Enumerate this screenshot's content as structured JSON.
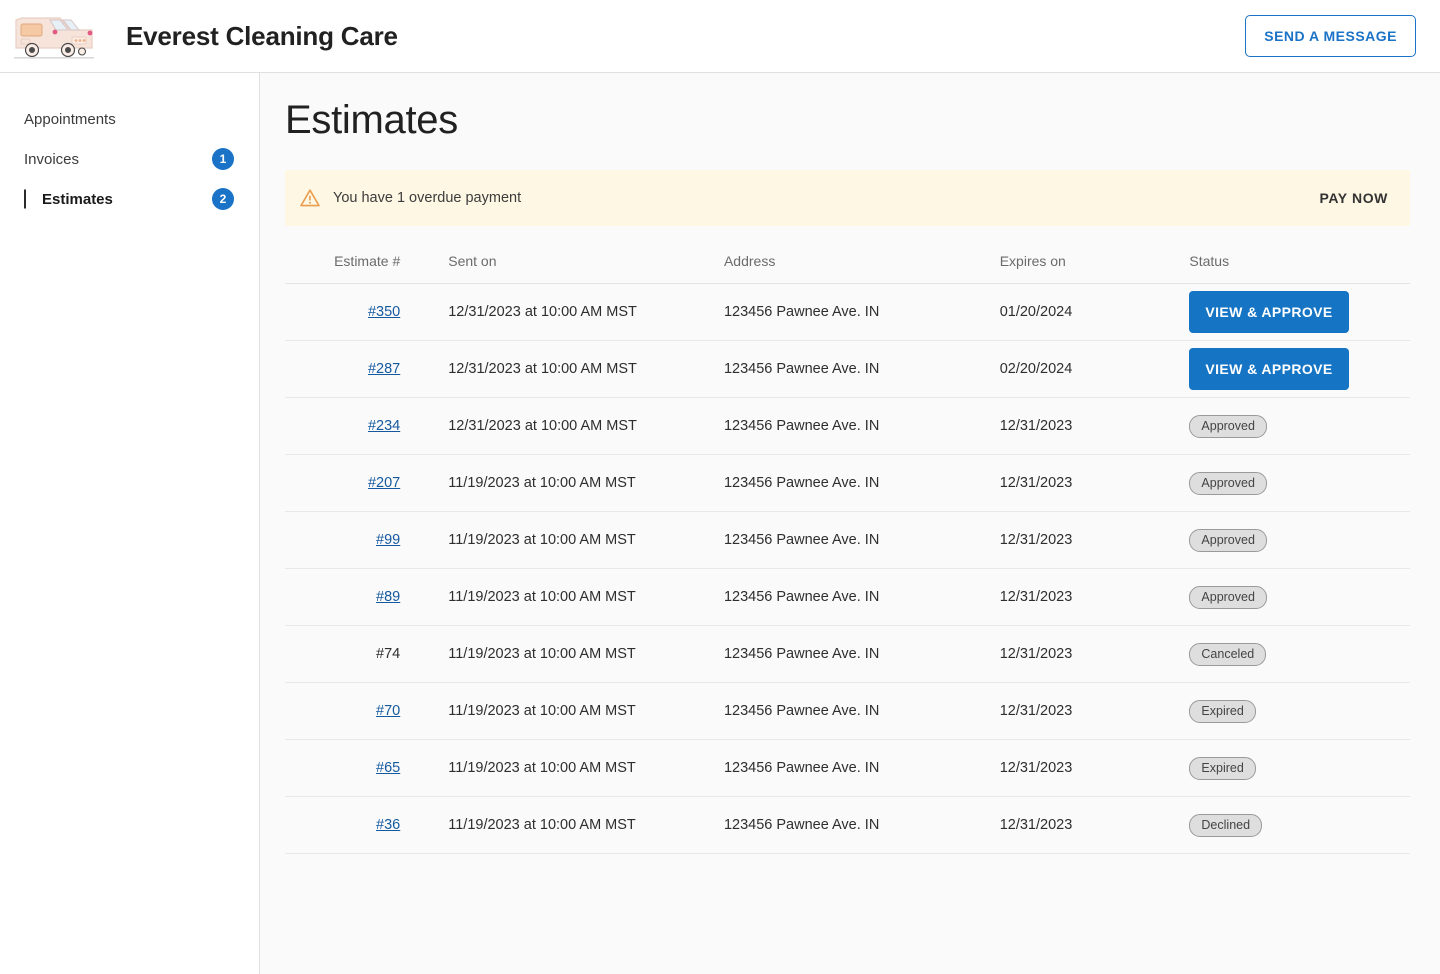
{
  "header": {
    "brand_title": "Everest Cleaning Care",
    "logo_icon": "cleaning-van-icon",
    "send_message_label": "SEND A MESSAGE"
  },
  "sidebar": {
    "items": [
      {
        "label": "Appointments",
        "badge": "",
        "active": false
      },
      {
        "label": "Invoices",
        "badge": "1",
        "active": false
      },
      {
        "label": "Estimates",
        "badge": "2",
        "active": true
      }
    ]
  },
  "main": {
    "page_title": "Estimates",
    "alert": {
      "icon": "warning-triangle-icon",
      "text": "You have 1 overdue payment",
      "action_label": "PAY NOW",
      "background": "#fdf7e3",
      "icon_color": "#eb9d4f"
    },
    "table": {
      "columns": [
        "Estimate #",
        "Sent on",
        "Address",
        "Expires on",
        "Status"
      ],
      "rows": [
        {
          "number": "#350",
          "is_link": true,
          "sent_on": "12/31/2023 at 10:00 AM MST",
          "address": "123456 Pawnee Ave. IN",
          "expires_on": "01/20/2024",
          "expires_overdue": true,
          "action_type": "button",
          "action_label": "VIEW & APPROVE"
        },
        {
          "number": "#287",
          "is_link": true,
          "sent_on": "12/31/2023 at 10:00 AM MST",
          "address": "123456 Pawnee Ave. IN",
          "expires_on": "02/20/2024",
          "expires_overdue": false,
          "action_type": "button",
          "action_label": "VIEW & APPROVE"
        },
        {
          "number": "#234",
          "is_link": true,
          "sent_on": "12/31/2023 at 10:00 AM MST",
          "address": "123456 Pawnee Ave. IN",
          "expires_on": "12/31/2023",
          "expires_overdue": false,
          "action_type": "badge",
          "action_label": "Approved"
        },
        {
          "number": "#207",
          "is_link": true,
          "sent_on": "11/19/2023 at 10:00 AM MST",
          "address": "123456 Pawnee Ave. IN",
          "expires_on": "12/31/2023",
          "expires_overdue": false,
          "action_type": "badge",
          "action_label": "Approved"
        },
        {
          "number": "#99",
          "is_link": true,
          "sent_on": "11/19/2023 at 10:00 AM MST",
          "address": "123456 Pawnee Ave. IN",
          "expires_on": "12/31/2023",
          "expires_overdue": false,
          "action_type": "badge",
          "action_label": "Approved"
        },
        {
          "number": "#89",
          "is_link": true,
          "sent_on": "11/19/2023 at 10:00 AM MST",
          "address": "123456 Pawnee Ave. IN",
          "expires_on": "12/31/2023",
          "expires_overdue": false,
          "action_type": "badge",
          "action_label": "Approved"
        },
        {
          "number": "#74",
          "is_link": false,
          "sent_on": "11/19/2023 at 10:00 AM MST",
          "address": "123456 Pawnee Ave. IN",
          "expires_on": "12/31/2023",
          "expires_overdue": false,
          "action_type": "badge",
          "action_label": "Canceled"
        },
        {
          "number": "#70",
          "is_link": true,
          "sent_on": "11/19/2023 at 10:00 AM MST",
          "address": "123456 Pawnee Ave. IN",
          "expires_on": "12/31/2023",
          "expires_overdue": false,
          "action_type": "badge",
          "action_label": "Expired"
        },
        {
          "number": "#65",
          "is_link": true,
          "sent_on": "11/19/2023 at 10:00 AM MST",
          "address": "123456 Pawnee Ave. IN",
          "expires_on": "12/31/2023",
          "expires_overdue": false,
          "action_type": "badge",
          "action_label": "Expired"
        },
        {
          "number": "#36",
          "is_link": true,
          "sent_on": "11/19/2023 at 10:00 AM MST",
          "address": "123456 Pawnee Ave. IN",
          "expires_on": "12/31/2023",
          "expires_overdue": false,
          "action_type": "badge",
          "action_label": "Declined"
        }
      ]
    }
  },
  "colors": {
    "accent_blue": "#1574c4",
    "link_blue": "#14599e",
    "overdue_red": "#d81b52",
    "alert_bg": "#fdf7e3",
    "badge_bg": "#dedede",
    "page_bg": "#fafafa"
  }
}
